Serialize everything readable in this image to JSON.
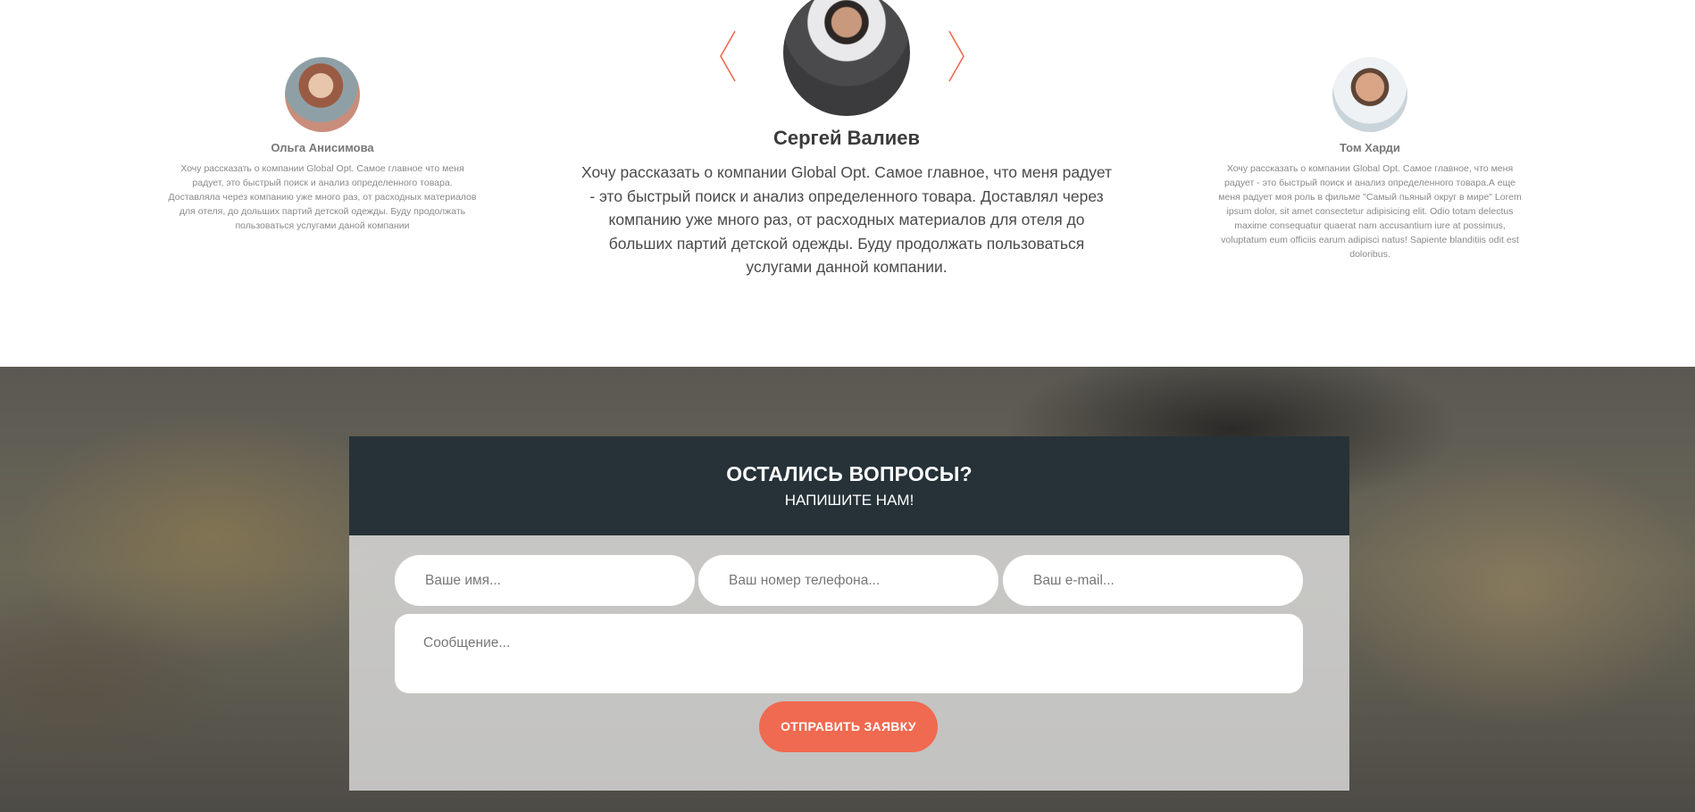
{
  "testimonials": {
    "prev_icon": "chevron-left-icon",
    "next_icon": "chevron-right-icon",
    "accent_color": "#ef6a50",
    "left": {
      "name": "Ольга Анисимова",
      "text": "Хочу рассказать о компании Global Opt. Самое главное что меня радует, это быстрый поиск и анализ определенного товара. Доставляла через компанию уже много раз, от расходных материалов для отеля, до дольших партий детской одежды. Буду продолжать пользоваться услугами даной компании"
    },
    "center": {
      "name": "Сергей Валиев",
      "text": "Хочу рассказать о компании Global Opt. Самое главное, что меня радует - это быстрый поиск и анализ определенного товара. Доставлял через компанию уже много раз, от расходных материалов для отеля до больших партий детской одежды. Буду продолжать пользоваться услугами данной компании."
    },
    "right": {
      "name": "Том Харди",
      "text": "Хочу рассказать о компании Global Opt. Самое главное, что меня радует - это быстрый поиск и анализ определенного товара.А еще меня радует моя роль в фильме \"Самый пьяный округ в мире\" Lorem ipsum dolor, sit amet consectetur adipisicing elit. Odio totam delectus maxime consequatur quaerat nam accusantium iure at possimus, voluptatum eum officiis earum adipisci natus! Sapiente blanditiis odit est doloribus."
    }
  },
  "contact": {
    "title": "ОСТАЛИСЬ ВОПРОСЫ?",
    "subtitle": "НАПИШИТЕ НАМ!",
    "name_placeholder": "Ваше имя...",
    "phone_placeholder": "Ваш номер телефона...",
    "email_placeholder": "Ваш e-mail...",
    "message_placeholder": "Сообщение...",
    "submit_label": "ОТПРАВИТЬ ЗАЯВКУ",
    "header_color": "#263238",
    "button_color": "#ef6a50"
  }
}
